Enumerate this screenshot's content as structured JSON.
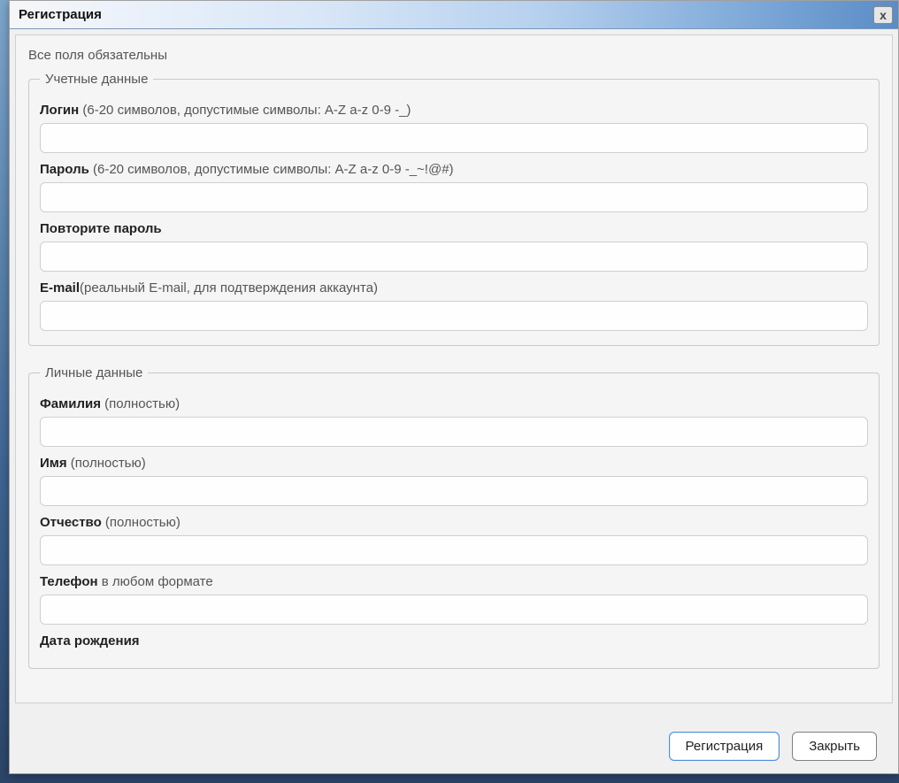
{
  "dialog": {
    "title": "Регистрация",
    "close_glyph": "x"
  },
  "form": {
    "required_note": "Все поля обязательны",
    "account": {
      "legend": "Учетные данные",
      "login": {
        "label": "Логин",
        "hint": " (6-20 символов, допустимые символы: A-Z a-z 0-9 -_)",
        "value": ""
      },
      "password": {
        "label": "Пароль",
        "hint": " (6-20 символов, допустимые символы: A-Z a-z 0-9 -_~!@#)",
        "value": ""
      },
      "password_repeat": {
        "label": "Повторите пароль",
        "hint": "",
        "value": ""
      },
      "email": {
        "label": "E-mail",
        "hint": "(реальный E-mail, для подтверждения аккаунта)",
        "value": ""
      }
    },
    "personal": {
      "legend": "Личные данные",
      "surname": {
        "label": "Фамилия",
        "hint": " (полностью)",
        "value": ""
      },
      "name": {
        "label": "Имя",
        "hint": " (полностью)",
        "value": ""
      },
      "patronymic": {
        "label": "Отчество",
        "hint": " (полностью)",
        "value": ""
      },
      "phone": {
        "label": "Телефон",
        "hint": " в любом формате",
        "value": ""
      },
      "dob": {
        "label": "Дата рождения",
        "hint": "",
        "value": ""
      }
    }
  },
  "buttons": {
    "submit": "Регистрация",
    "close": "Закрыть"
  }
}
